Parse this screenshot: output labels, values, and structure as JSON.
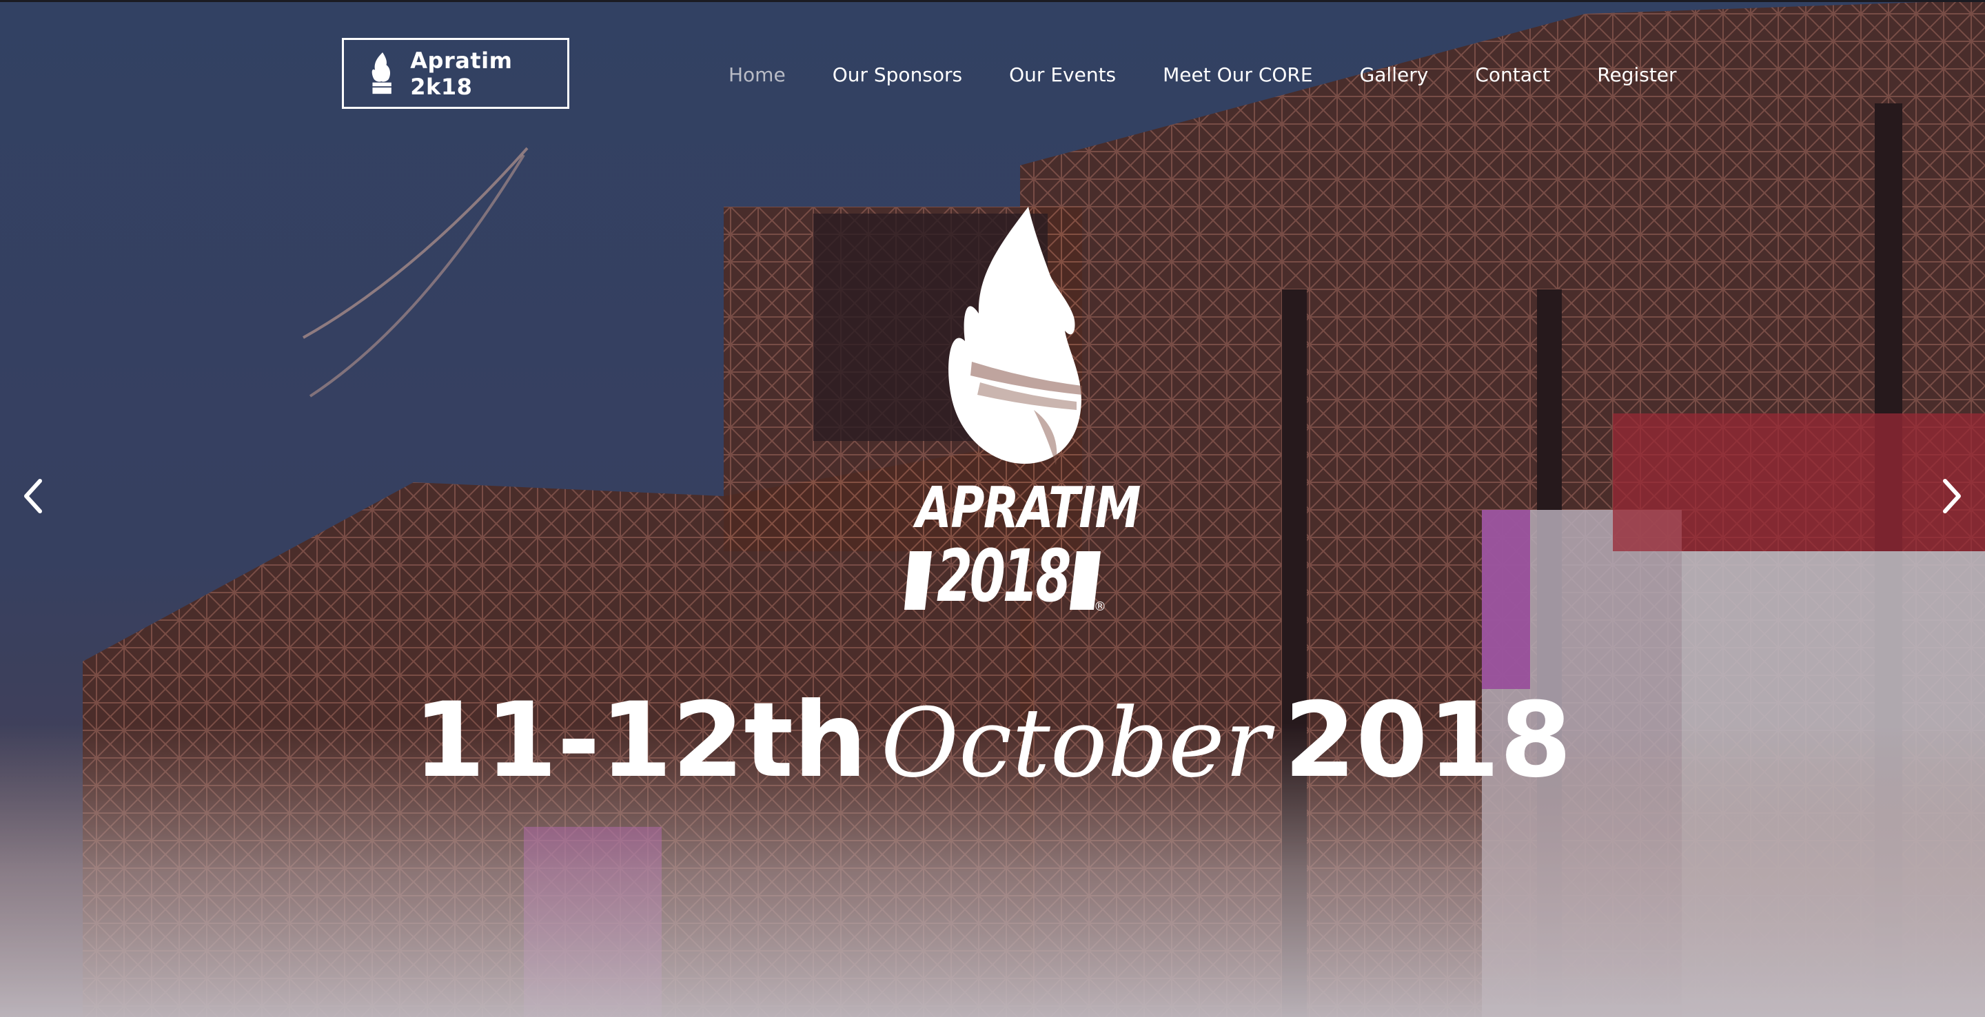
{
  "brand": {
    "name": "Apratim 2k18",
    "logo_icon": "flame-logo-icon"
  },
  "nav": {
    "items": [
      {
        "label": "Home",
        "active": true
      },
      {
        "label": "Our Sponsors",
        "active": false
      },
      {
        "label": "Our Events",
        "active": false
      },
      {
        "label": "Meet Our CORE",
        "active": false
      },
      {
        "label": "Gallery",
        "active": false
      },
      {
        "label": "Contact",
        "active": false
      },
      {
        "label": "Register",
        "active": false
      }
    ]
  },
  "hero": {
    "logo_word": "APRATIM",
    "logo_year": "2018",
    "logo_mark": "®",
    "date_prefix": "11-12th",
    "date_month": "October",
    "date_year": "2018",
    "prev_icon": "chevron-left-icon",
    "next_icon": "chevron-right-icon"
  },
  "colors": {
    "text": "#ffffff",
    "nav_active": "#b9bcc6",
    "sky": "#3c4a70",
    "stage": "#6e3a2d"
  }
}
